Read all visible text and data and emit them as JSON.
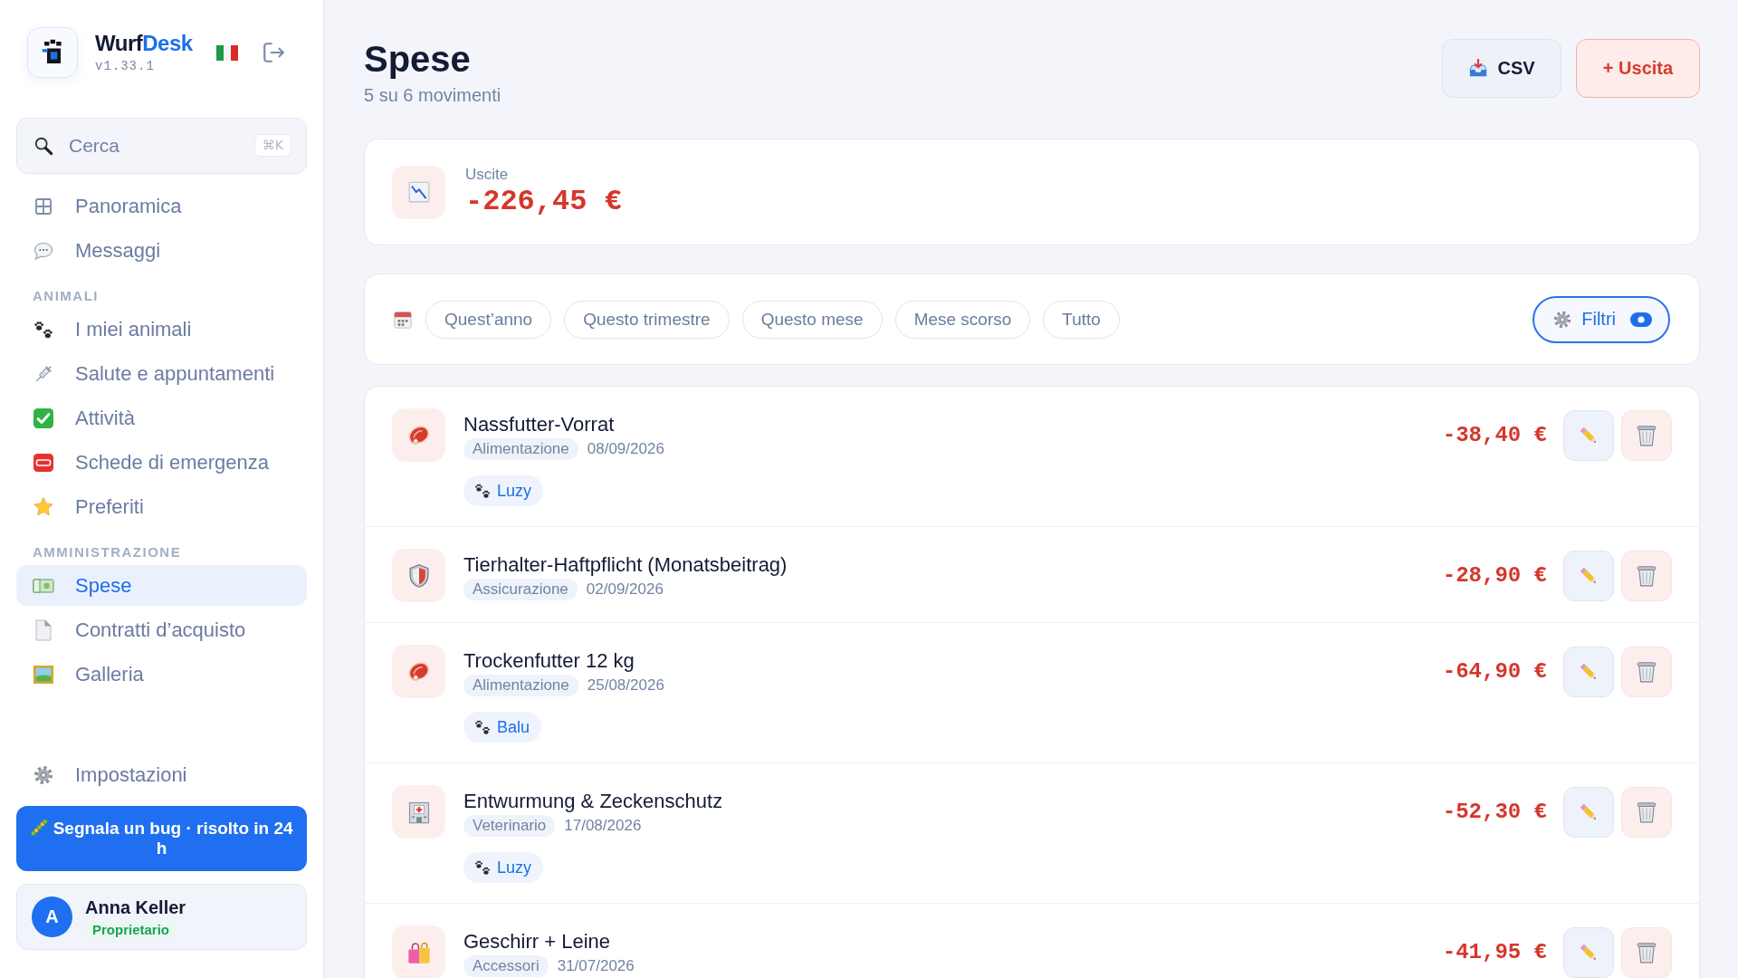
{
  "sidebar": {
    "brand": {
      "name": "Wurf",
      "name_accent": "Desk",
      "version": "v1.33.1"
    },
    "search": {
      "placeholder": "Cerca",
      "shortcut": "⌘K"
    },
    "nav": [
      {
        "label": "Panoramica",
        "selected": false
      },
      {
        "label": "Messaggi",
        "selected": false
      }
    ],
    "sections": [
      {
        "heading": "ANIMALI",
        "items": [
          {
            "label": "I miei animali",
            "selected": false
          },
          {
            "label": "Salute e appuntamenti",
            "selected": false
          },
          {
            "label": "Attività",
            "selected": false
          },
          {
            "label": "Schede di emergenza",
            "selected": false
          },
          {
            "label": "Preferiti",
            "selected": false
          }
        ]
      },
      {
        "heading": "AMMINISTRAZIONE",
        "items": [
          {
            "label": "Spese",
            "selected": true
          },
          {
            "label": "Contratti d’acquisto",
            "selected": false
          },
          {
            "label": "Galleria",
            "selected": false
          }
        ]
      }
    ],
    "settings": {
      "label": "Impostazioni",
      "selected": false
    },
    "report_bug_button": "Segnala un bug · risolto in 24 h",
    "user": {
      "initial": "A",
      "name": "Anna Keller",
      "role": "Proprietario"
    }
  },
  "header": {
    "title": "Spese",
    "subtitle": "5 su 6 movimenti",
    "export_button": "CSV",
    "add_button": "+ Uscita"
  },
  "summary": {
    "label": "Uscite",
    "amount": "-226,45 €"
  },
  "period_filter": {
    "chips": [
      {
        "label": "Quest’anno",
        "selected": false
      },
      {
        "label": "Questo trimestre",
        "selected": false
      },
      {
        "label": "Questo mese",
        "selected": false
      },
      {
        "label": "Mese scorso",
        "selected": false
      },
      {
        "label": "Tutto",
        "selected": false
      }
    ],
    "filter_button": {
      "label": "Filtri",
      "active": true
    }
  },
  "expenses": [
    {
      "title": "Nassfutter-Vorrat",
      "category": "Alimentazione",
      "date": "08/09/2026",
      "pet": "Luzy",
      "amount": "-38,40 €"
    },
    {
      "title": "Tierhalter-Haftpflicht (Monatsbeitrag)",
      "category": "Assicurazione",
      "date": "02/09/2026",
      "amount": "-28,90 €"
    },
    {
      "title": "Trockenfutter 12 kg",
      "category": "Alimentazione",
      "date": "25/08/2026",
      "pet": "Balu",
      "amount": "-64,90 €"
    },
    {
      "title": "Entwurmung & Zeckenschutz",
      "category": "Veterinario",
      "date": "17/08/2026",
      "pet": "Luzy",
      "amount": "-52,30 €"
    },
    {
      "title": "Geschirr + Leine",
      "category": "Accessori",
      "date": "31/07/2026",
      "amount": "-41,95 €"
    }
  ]
}
